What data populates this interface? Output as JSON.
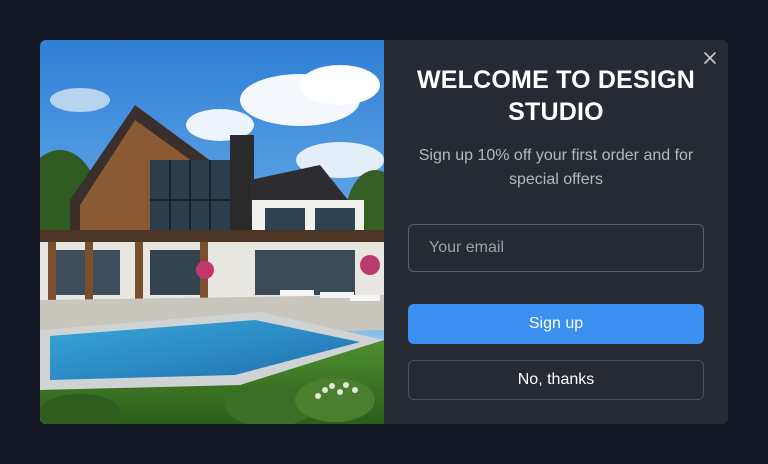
{
  "modal": {
    "title": "WELCOME TO DESIGN STUDIO",
    "subtitle": "Sign up 10% off your first order and for special offers",
    "email_placeholder": "Your email",
    "signup_label": "Sign up",
    "dismiss_label": "No, thanks",
    "close_icon": "close-icon",
    "hero_image": "modern-house-with-pool"
  },
  "colors": {
    "page_background": "#121723",
    "panel_background": "#262b33",
    "primary_button": "#3b8ff0",
    "input_border": "#5b616b"
  }
}
